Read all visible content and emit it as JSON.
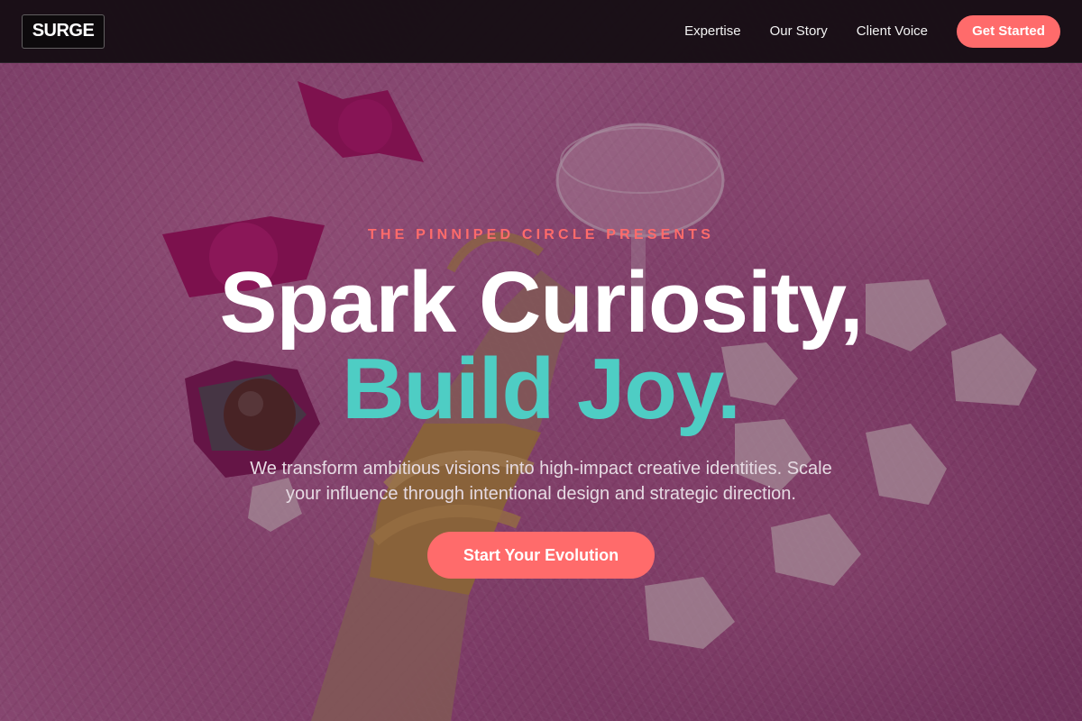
{
  "brand": {
    "logo_text": "SURGE"
  },
  "nav": {
    "links": [
      "Expertise",
      "Our Story",
      "Client Voice"
    ],
    "cta_label": "Get Started"
  },
  "hero": {
    "eyebrow": "THE PINNIPED CIRCLE PRESENTS",
    "headline_line1": "Spark Curiosity,",
    "headline_line2": "Build Joy.",
    "subtitle": "We transform ambitious visions into high-impact creative identities. Scale your influence through intentional design and strategic direction.",
    "cta_label": "Start Your Evolution"
  },
  "colors": {
    "accent": "#ff6b6b",
    "teal": "#4ecdc4",
    "nav_bg": "#160e14",
    "hero_tint": "#b25f93"
  }
}
